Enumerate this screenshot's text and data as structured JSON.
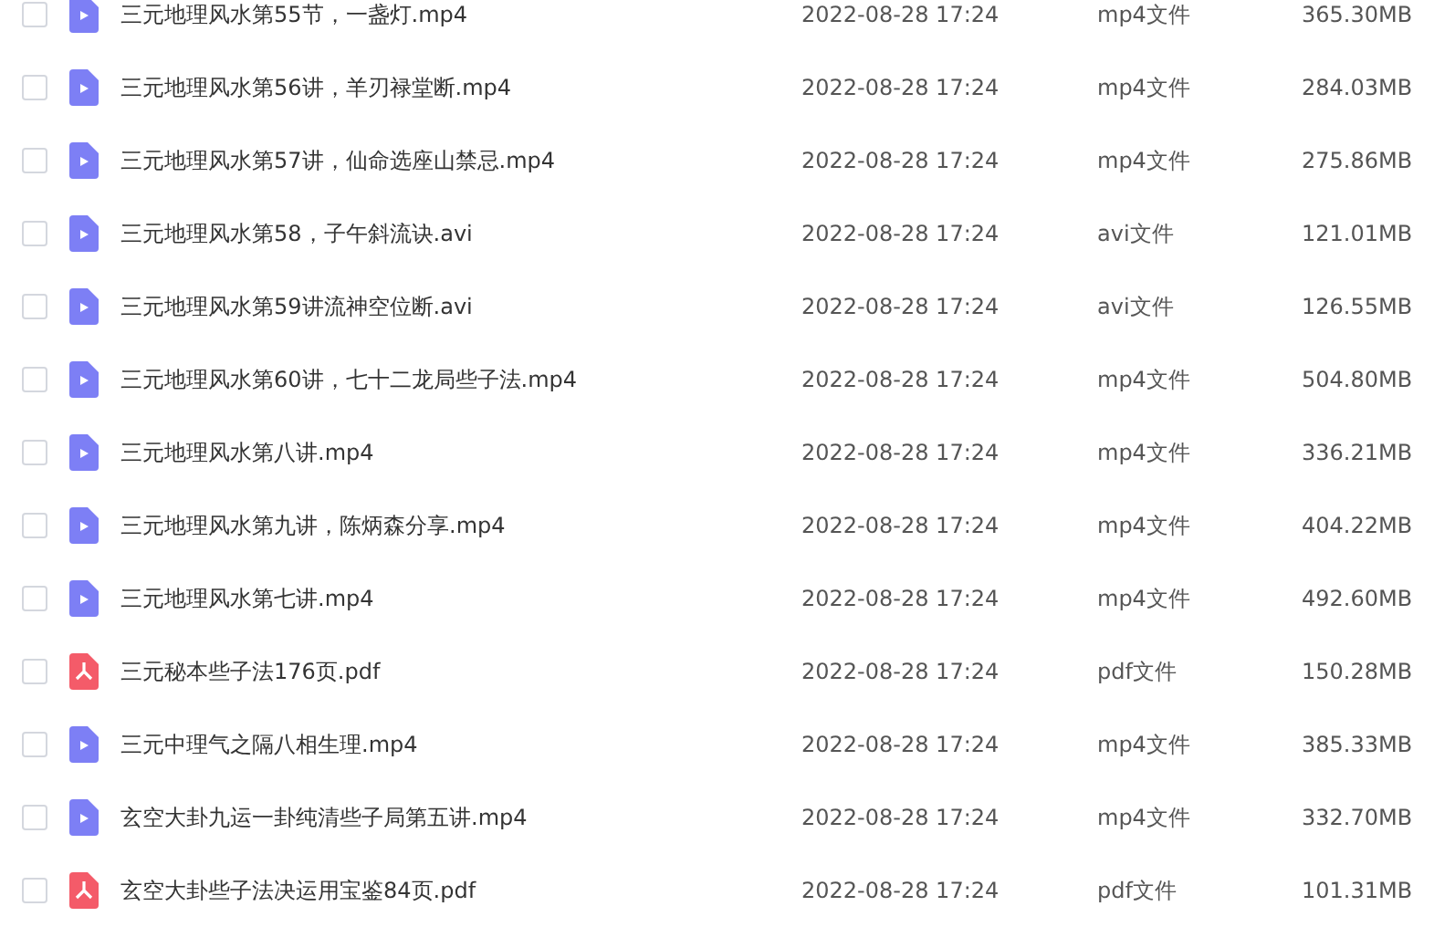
{
  "files": [
    {
      "kind": "video",
      "name": "三元地理风水第55节，一盏灯.mp4",
      "date": "2022-08-28 17:24",
      "type": "mp4文件",
      "size": "365.30MB",
      "checked": false
    },
    {
      "kind": "video",
      "name": "三元地理风水第56讲，羊刃禄堂断.mp4",
      "date": "2022-08-28 17:24",
      "type": "mp4文件",
      "size": "284.03MB",
      "checked": false
    },
    {
      "kind": "video",
      "name": "三元地理风水第57讲，仙命选座山禁忌.mp4",
      "date": "2022-08-28 17:24",
      "type": "mp4文件",
      "size": "275.86MB",
      "checked": false
    },
    {
      "kind": "video",
      "name": "三元地理风水第58，子午斜流诀.avi",
      "date": "2022-08-28 17:24",
      "type": "avi文件",
      "size": "121.01MB",
      "checked": false
    },
    {
      "kind": "video",
      "name": "三元地理风水第59讲流神空位断.avi",
      "date": "2022-08-28 17:24",
      "type": "avi文件",
      "size": "126.55MB",
      "checked": false
    },
    {
      "kind": "video",
      "name": "三元地理风水第60讲，七十二龙局些子法.mp4",
      "date": "2022-08-28 17:24",
      "type": "mp4文件",
      "size": "504.80MB",
      "checked": false
    },
    {
      "kind": "video",
      "name": "三元地理风水第八讲.mp4",
      "date": "2022-08-28 17:24",
      "type": "mp4文件",
      "size": "336.21MB",
      "checked": false
    },
    {
      "kind": "video",
      "name": "三元地理风水第九讲，陈炳森分享.mp4",
      "date": "2022-08-28 17:24",
      "type": "mp4文件",
      "size": "404.22MB",
      "checked": false
    },
    {
      "kind": "video",
      "name": "三元地理风水第七讲.mp4",
      "date": "2022-08-28 17:24",
      "type": "mp4文件",
      "size": "492.60MB",
      "checked": false
    },
    {
      "kind": "pdf",
      "name": "三元秘本些子法176页.pdf",
      "date": "2022-08-28 17:24",
      "type": "pdf文件",
      "size": "150.28MB",
      "checked": false
    },
    {
      "kind": "video",
      "name": "三元中理气之隔八相生理.mp4",
      "date": "2022-08-28 17:24",
      "type": "mp4文件",
      "size": "385.33MB",
      "checked": false
    },
    {
      "kind": "video",
      "name": "玄空大卦九运一卦纯清些子局第五讲.mp4",
      "date": "2022-08-28 17:24",
      "type": "mp4文件",
      "size": "332.70MB",
      "checked": false
    },
    {
      "kind": "pdf",
      "name": "玄空大卦些子法决运用宝鉴84页.pdf",
      "date": "2022-08-28 17:24",
      "type": "pdf文件",
      "size": "101.31MB",
      "checked": false
    }
  ]
}
